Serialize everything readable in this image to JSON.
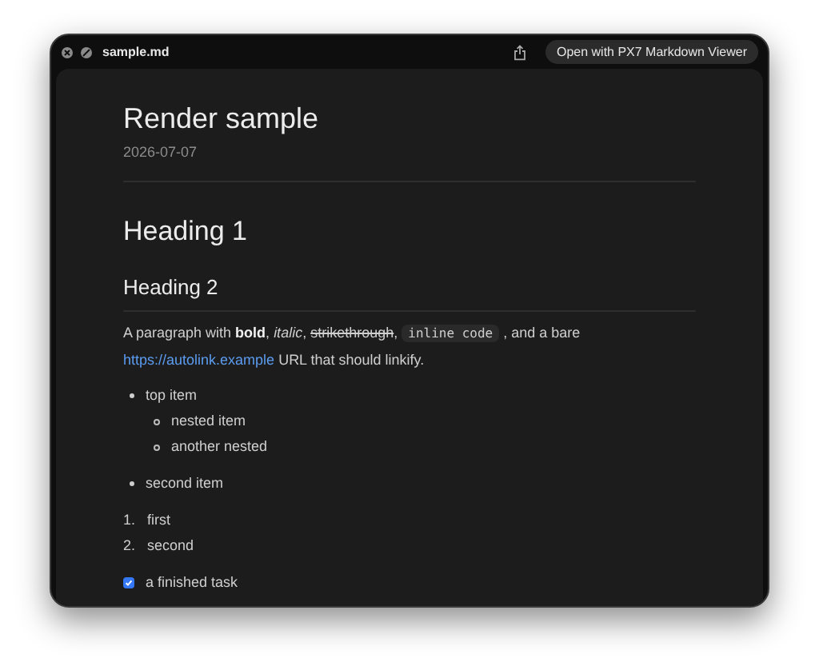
{
  "window": {
    "title": "sample.md",
    "open_button": "Open with PX7 Markdown Viewer"
  },
  "document": {
    "title": "Render sample",
    "date": "2026-07-07",
    "heading_1": "Heading 1",
    "heading_2": "Heading 2",
    "paragraph": [
      {
        "kind": "text",
        "text": "A paragraph with "
      },
      {
        "kind": "bold",
        "text": "bold"
      },
      {
        "kind": "text",
        "text": ", "
      },
      {
        "kind": "italic",
        "text": "italic"
      },
      {
        "kind": "text",
        "text": ", "
      },
      {
        "kind": "strike",
        "text": "strikethrough"
      },
      {
        "kind": "text",
        "text": ", "
      },
      {
        "kind": "code",
        "text": "inline code"
      },
      {
        "kind": "text",
        "text": " , and a bare "
      },
      {
        "kind": "link",
        "text": "https://autolink.example"
      },
      {
        "kind": "text",
        "text": " URL that should linkify."
      }
    ],
    "bullet_list": [
      {
        "text": "top item",
        "children": [
          {
            "text": "nested item"
          },
          {
            "text": "another nested"
          }
        ]
      },
      {
        "text": "second item"
      }
    ],
    "ordered_list": [
      {
        "marker": "1.",
        "text": "first"
      },
      {
        "marker": "2.",
        "text": "second"
      }
    ],
    "task_list": [
      {
        "text": "a finished task",
        "checked": true
      }
    ]
  }
}
